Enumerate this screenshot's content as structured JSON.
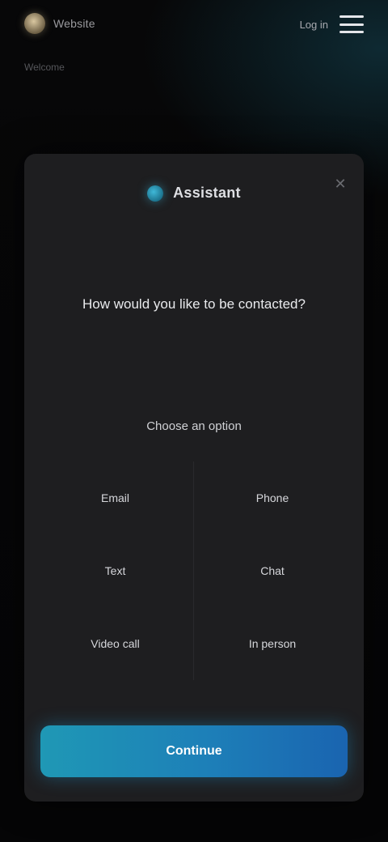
{
  "topbar": {
    "brand_name": "Website",
    "nav_link": "Log in",
    "menu_icon": "hamburger-menu-icon"
  },
  "header": {
    "subtitle": "Welcome"
  },
  "card": {
    "brand_name": "Assistant",
    "close_icon": "close-icon",
    "question": "How would you like to be contacted?",
    "field_label": "Choose an option",
    "options": [
      {
        "label": "Email"
      },
      {
        "label": "Phone"
      },
      {
        "label": "Text"
      },
      {
        "label": "Chat"
      },
      {
        "label": "Video call"
      },
      {
        "label": "In person"
      }
    ],
    "cta_label": "Continue"
  },
  "colors": {
    "accent": "#1f98b5",
    "accent_end": "#1a64b0",
    "card_bg": "#1e1e20",
    "page_bg": "#050506"
  }
}
